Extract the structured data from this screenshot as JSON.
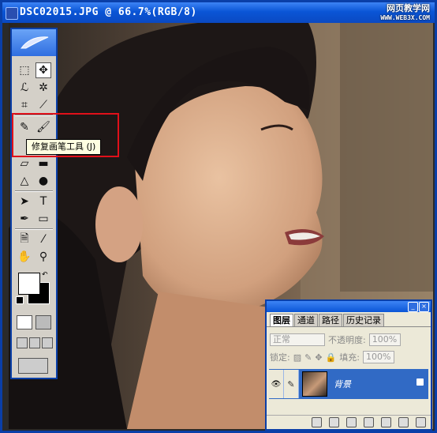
{
  "window": {
    "title": "DSC02015.JPG @ 66.7%(RGB/8)",
    "min_glyph": "_",
    "max_glyph": "□",
    "close_glyph": "×",
    "watermark_text": "网页教学网",
    "watermark_url": "WWW.WEB3X.COM"
  },
  "toolbox": {
    "tooltip": "修复画笔工具 (J)",
    "tools": [
      {
        "name": "marquee",
        "glyph": "⬚"
      },
      {
        "name": "move",
        "glyph": "✥"
      },
      {
        "name": "lasso",
        "glyph": "ℒ"
      },
      {
        "name": "magic-wand",
        "glyph": "✲"
      },
      {
        "name": "crop",
        "glyph": "⌗"
      },
      {
        "name": "slice",
        "glyph": "⟋"
      },
      {
        "name": "healing-brush",
        "glyph": "✎"
      },
      {
        "name": "brush",
        "glyph": "🖌"
      },
      {
        "name": "stamp",
        "glyph": "⚲"
      },
      {
        "name": "history-brush",
        "glyph": "ɣ"
      },
      {
        "name": "eraser",
        "glyph": "▱"
      },
      {
        "name": "gradient",
        "glyph": "▬"
      },
      {
        "name": "blur",
        "glyph": "△"
      },
      {
        "name": "dodge",
        "glyph": "●"
      },
      {
        "name": "path-select",
        "glyph": "➤"
      },
      {
        "name": "type",
        "glyph": "T"
      },
      {
        "name": "pen",
        "glyph": "✒"
      },
      {
        "name": "shape",
        "glyph": "▭"
      },
      {
        "name": "notes",
        "glyph": "🗎"
      },
      {
        "name": "eyedropper",
        "glyph": "⁄"
      },
      {
        "name": "hand",
        "glyph": "✋"
      },
      {
        "name": "zoom",
        "glyph": "⚲"
      }
    ]
  },
  "layers_panel": {
    "tabs": [
      "图层",
      "通道",
      "路径",
      "历史记录"
    ],
    "active_tab": "图层",
    "blend_mode": "正常",
    "opacity_label": "不透明度:",
    "opacity_value": "100%",
    "lock_label": "锁定:",
    "fill_label": "填充:",
    "fill_value": "100%",
    "layer_name": "背景"
  },
  "colors": {
    "titlebar": "#0a55d6",
    "highlight": "#e0101a",
    "selected_layer": "#316ac5"
  }
}
